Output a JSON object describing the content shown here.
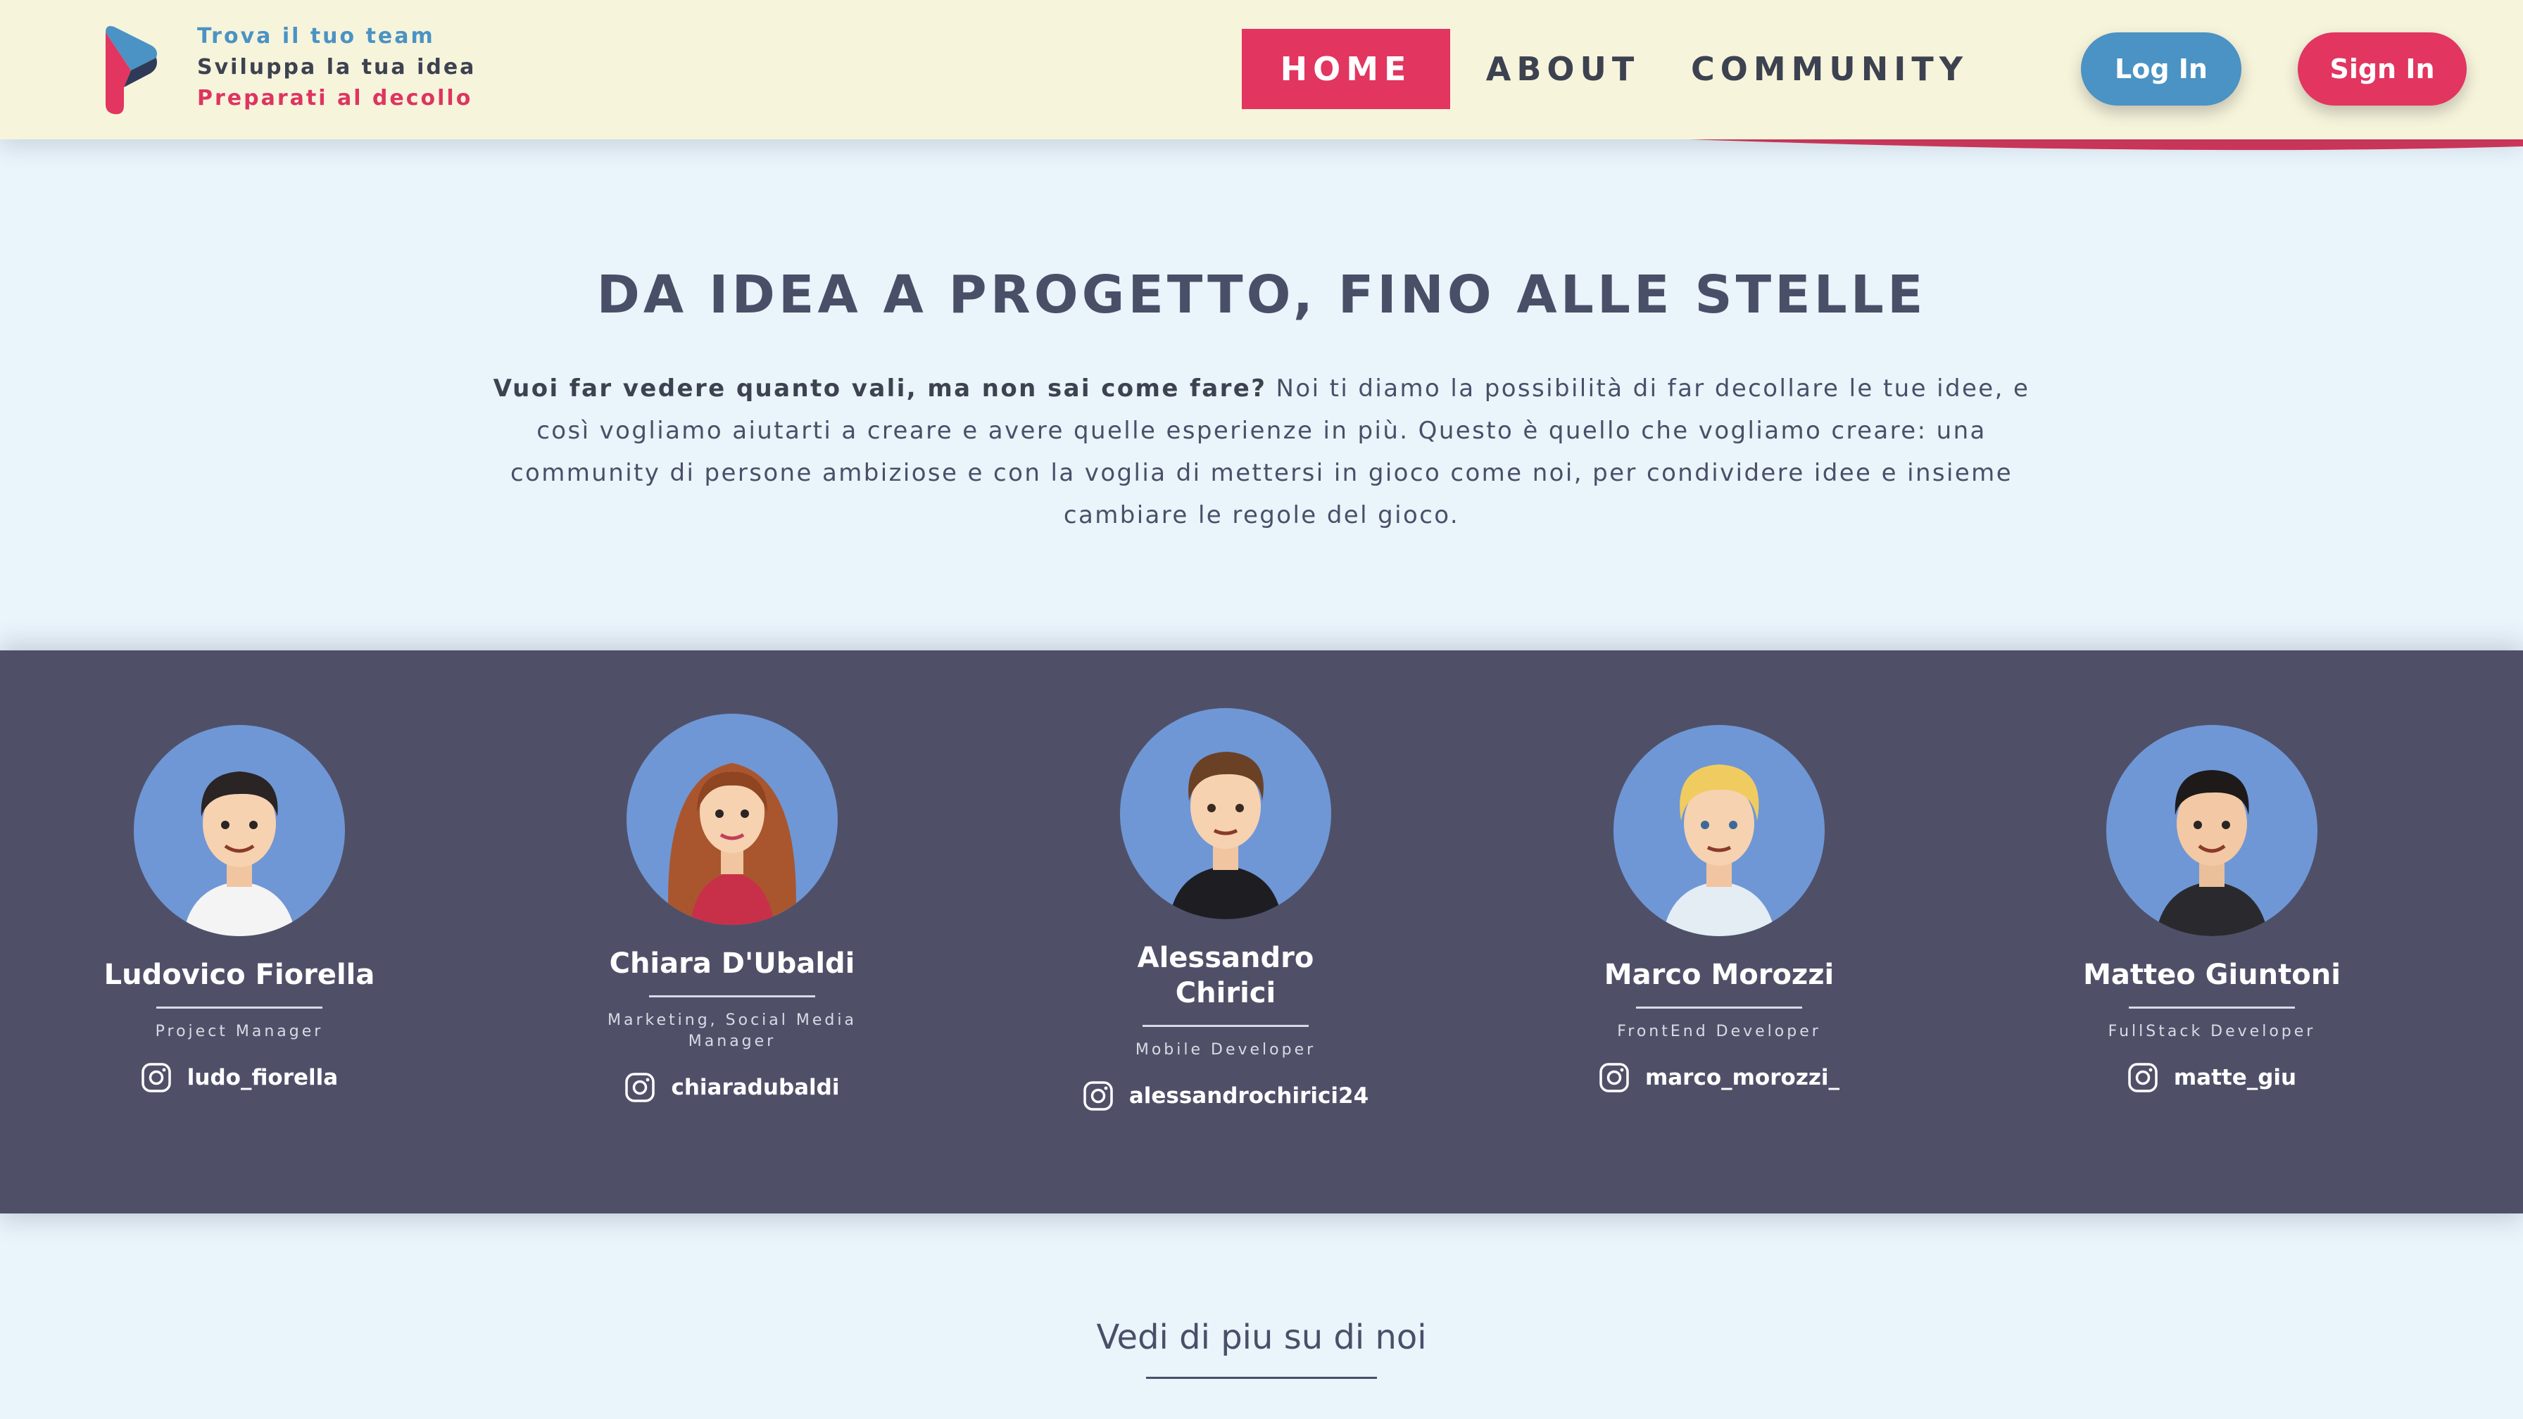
{
  "header": {
    "taglines": [
      "Trova il tuo team",
      "Sviluppa la tua idea",
      "Preparati al decollo"
    ],
    "nav": {
      "home": "HOME",
      "about": "ABOUT",
      "community": "COMMUNITY"
    },
    "login_label": "Log In",
    "signin_label": "Sign In"
  },
  "hero": {
    "title": "DA IDEA A PROGETTO, FINO ALLE STELLE",
    "lead_bold": "Vuoi far vedere quanto vali, ma non sai come fare?",
    "lead_text": " Noi ti diamo la possibilità di far decollare le tue idee, e così vogliamo aiutarti a creare e avere quelle esperienze in più. Questo è quello che vogliamo creare: una community di persone ambiziose e con la voglia di mettersi in gioco come noi, per condividere idee e insieme cambiare le regole del gioco."
  },
  "team": {
    "members": [
      {
        "name": "Ludovico Fiorella",
        "role": "Project Manager",
        "handle": "ludo_fiorella"
      },
      {
        "name": "Chiara D'Ubaldi",
        "role": "Marketing, Social Media Manager",
        "handle": "chiaradubaldi"
      },
      {
        "name": "Alessandro Chirici",
        "role": "Mobile Developer",
        "handle": "alessandrochirici24"
      },
      {
        "name": "Marco Morozzi",
        "role": "FrontEnd Developer",
        "handle": "marco_morozzi_"
      },
      {
        "name": "Matteo Giuntoni",
        "role": "FullStack Developer",
        "handle": "matte_giu"
      }
    ]
  },
  "footer": {
    "more_label": "Vedi di piu su di noi"
  },
  "colors": {
    "brand_pink": "#e23560",
    "brand_blue": "#4a93c4",
    "header_bg": "#f7f4dc",
    "page_bg": "#e9f4fb",
    "team_bg": "#4f5068",
    "avatar_bg": "#6f97d6"
  },
  "icons": [
    "logo-icon",
    "instagram-icon",
    "avatar-portrait"
  ]
}
